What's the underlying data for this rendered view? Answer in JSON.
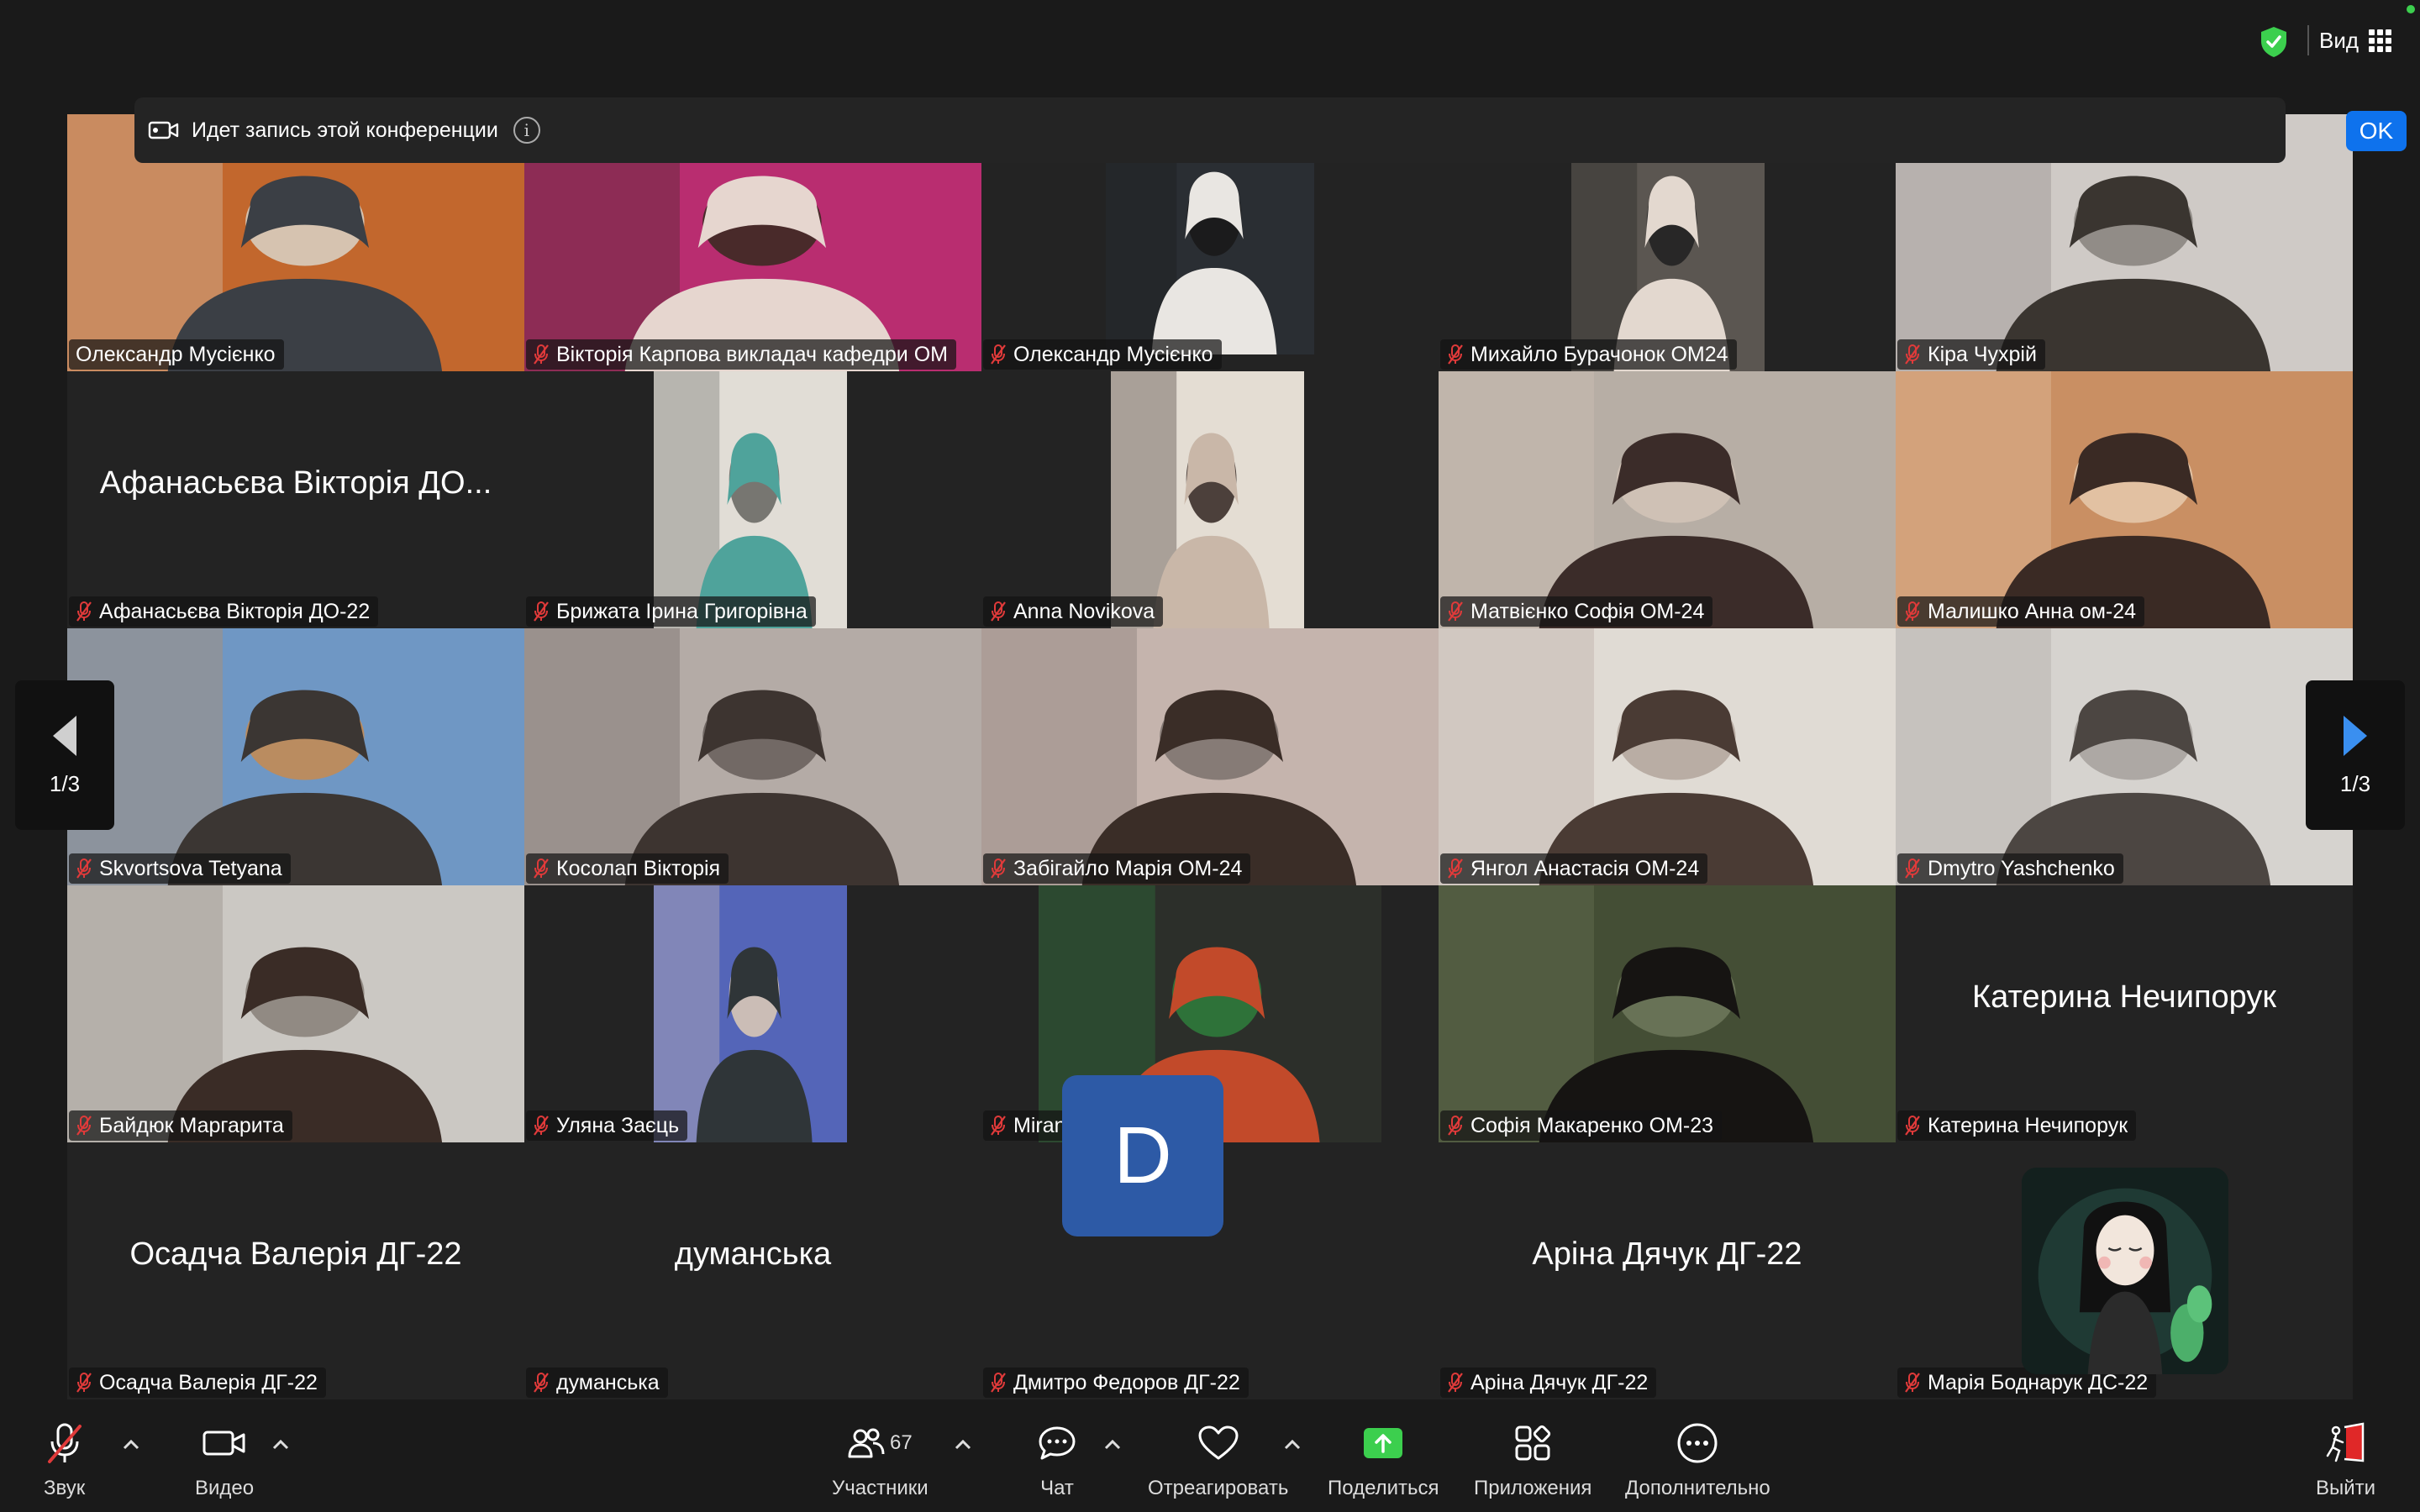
{
  "topbar": {
    "view_label": "Вид"
  },
  "banner": {
    "text": "Идет запись этой конференции",
    "ok_label": "OK"
  },
  "pagination": {
    "left_label": "1/3",
    "right_label": "1/3"
  },
  "tiles": [
    {
      "name": "Олександр Мусієнко",
      "muted": false,
      "active": true,
      "kind": "video",
      "bg": "#8a4a2a"
    },
    {
      "name": "Вікторія Карпова викладач кафедри ОМ",
      "muted": true,
      "kind": "video",
      "bg": "#9b2a5e"
    },
    {
      "name": "Олександр Мусієнко",
      "muted": true,
      "kind": "video",
      "bg": "#3a3632"
    },
    {
      "name": "Михайло Бурачонок ОМ24",
      "muted": true,
      "kind": "video",
      "bg": "#6b6a68"
    },
    {
      "name": "Кіра Чухрій",
      "muted": true,
      "kind": "video",
      "bg": "#8d8a86"
    },
    {
      "name": "Афанасьєва Вікторія ДО-22",
      "muted": true,
      "kind": "name",
      "big": "Афанасьєва Вікторія ДО..."
    },
    {
      "name": "Брижата Ірина Григорівна",
      "muted": true,
      "kind": "video",
      "bg": "#c9c4bb"
    },
    {
      "name": "Anna Novikova",
      "muted": true,
      "kind": "video",
      "bg": "#d8d1c7"
    },
    {
      "name": "Матвієнко Софія ОМ-24",
      "muted": true,
      "kind": "video",
      "bg": "#a08f82"
    },
    {
      "name": "Малишко Анна ом-24",
      "muted": true,
      "kind": "video",
      "bg": "#b07c5a"
    },
    {
      "name": "Skvortsova Tetyana",
      "muted": true,
      "kind": "video",
      "bg": "#5a7fa3"
    },
    {
      "name": "Косолап Вікторія",
      "muted": true,
      "kind": "video",
      "bg": "#8e8580"
    },
    {
      "name": "Забігайло Марія ОМ-24",
      "muted": true,
      "kind": "video",
      "bg": "#9d8a85"
    },
    {
      "name": "Янгол Анастасія ОМ-24",
      "muted": true,
      "kind": "video",
      "bg": "#b8b2ac"
    },
    {
      "name": "Dmytro Yashchenko",
      "muted": true,
      "kind": "video",
      "bg": "#c4c0bc"
    },
    {
      "name": "Байдюк Маргарита",
      "muted": true,
      "kind": "video",
      "bg": "#a8a49e"
    },
    {
      "name": "Уляна Заєць",
      "muted": true,
      "kind": "video",
      "bg": "#4d5fa8"
    },
    {
      "name": "Miranda Yakovlieva",
      "muted": true,
      "kind": "video",
      "bg": "#4a4d45"
    },
    {
      "name": "Софія Макаренко ОМ-23",
      "muted": true,
      "kind": "video",
      "bg": "#3e4a2e"
    },
    {
      "name": "Катерина Нечипорук",
      "muted": true,
      "kind": "name",
      "big": "Катерина Нечипорук"
    },
    {
      "name": "Осадча Валерія ДГ-22",
      "muted": true,
      "kind": "name",
      "big": "Осадча Валерія ДГ-22"
    },
    {
      "name": "думанська",
      "muted": true,
      "kind": "name",
      "big": "думанська"
    },
    {
      "name": "Дмитро Федоров ДГ-22",
      "muted": true,
      "kind": "avatar",
      "letter": "D"
    },
    {
      "name": "Аріна Дячук ДГ-22",
      "muted": true,
      "kind": "name",
      "big": "Аріна Дячук ДГ-22"
    },
    {
      "name": "Марія Боднарук ДС-22",
      "muted": true,
      "kind": "avatar-img"
    }
  ],
  "toolbar": {
    "audio_label": "Звук",
    "video_label": "Видео",
    "participants_label": "Участники",
    "participants_count": "67",
    "chat_label": "Чат",
    "react_label": "Отреагировать",
    "share_label": "Поделиться",
    "apps_label": "Приложения",
    "more_label": "Дополнительно",
    "leave_label": "Выйти"
  },
  "colors": {
    "accent": "#0e72ed",
    "active_border": "#5ad25a",
    "share_green": "#3ccf4e",
    "muted_red": "#e03a3a",
    "leave_red": "#e02828"
  }
}
